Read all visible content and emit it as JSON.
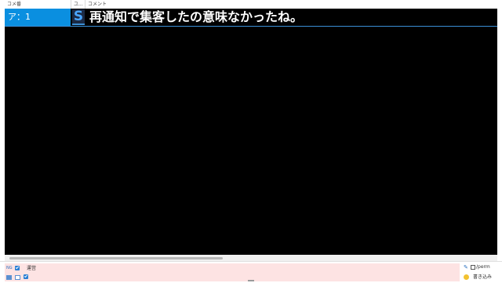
{
  "header": {
    "col_number": "コメ番",
    "col_user": "ユ...",
    "col_comment": "コメント"
  },
  "comments": [
    {
      "number": "ア：1",
      "user_icon": "S",
      "text": "再通知で集客したの意味なかったね。"
    }
  ],
  "input_panel": {
    "ng_label": "NG",
    "checkbox_label": "運営",
    "perm_label": "/perm",
    "submit_label": "書き込み"
  },
  "colors": {
    "list_background": "#000000",
    "selected_number_bg": "#0a8fe0",
    "input_background": "#fde3e3",
    "accent": "#2a7fd4"
  }
}
